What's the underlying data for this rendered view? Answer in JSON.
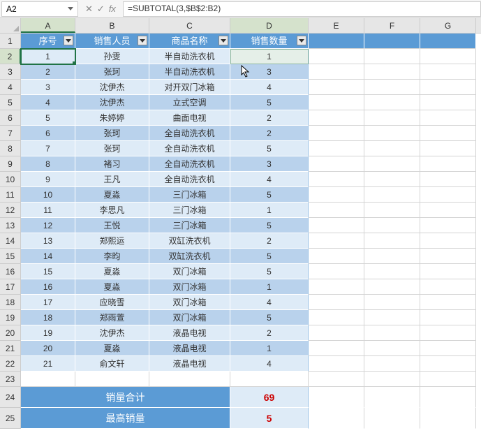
{
  "name_box": "A2",
  "formula": "=SUBTOTAL(3,$B$2:B2)",
  "cols": [
    "A",
    "B",
    "C",
    "D",
    "E",
    "F",
    "G"
  ],
  "headers": {
    "seq": "序号",
    "person": "销售人员",
    "product": "商品名称",
    "qty": "销售数量"
  },
  "chart_data": {
    "type": "table",
    "columns": [
      "序号",
      "销售人员",
      "商品名称",
      "销售数量"
    ],
    "rows": [
      {
        "seq": 1,
        "person": "孙雯",
        "product": "半自动洗衣机",
        "qty": 1
      },
      {
        "seq": 2,
        "person": "张珂",
        "product": "半自动洗衣机",
        "qty": 3
      },
      {
        "seq": 3,
        "person": "沈伊杰",
        "product": "对开双门冰箱",
        "qty": 4
      },
      {
        "seq": 4,
        "person": "沈伊杰",
        "product": "立式空调",
        "qty": 5
      },
      {
        "seq": 5,
        "person": "朱婷婷",
        "product": "曲面电视",
        "qty": 2
      },
      {
        "seq": 6,
        "person": "张珂",
        "product": "全自动洗衣机",
        "qty": 2
      },
      {
        "seq": 7,
        "person": "张珂",
        "product": "全自动洗衣机",
        "qty": 5
      },
      {
        "seq": 8,
        "person": "褚习",
        "product": "全自动洗衣机",
        "qty": 3
      },
      {
        "seq": 9,
        "person": "王凡",
        "product": "全自动洗衣机",
        "qty": 4
      },
      {
        "seq": 10,
        "person": "夏淼",
        "product": "三门冰箱",
        "qty": 5
      },
      {
        "seq": 11,
        "person": "李思凡",
        "product": "三门冰箱",
        "qty": 1
      },
      {
        "seq": 12,
        "person": "王悦",
        "product": "三门冰箱",
        "qty": 5
      },
      {
        "seq": 13,
        "person": "郑熙运",
        "product": "双缸洗衣机",
        "qty": 2
      },
      {
        "seq": 14,
        "person": "李昀",
        "product": "双缸洗衣机",
        "qty": 5
      },
      {
        "seq": 15,
        "person": "夏淼",
        "product": "双门冰箱",
        "qty": 5
      },
      {
        "seq": 16,
        "person": "夏淼",
        "product": "双门冰箱",
        "qty": 1
      },
      {
        "seq": 17,
        "person": "应晓雪",
        "product": "双门冰箱",
        "qty": 4
      },
      {
        "seq": 18,
        "person": "郑雨萱",
        "product": "双门冰箱",
        "qty": 5
      },
      {
        "seq": 19,
        "person": "沈伊杰",
        "product": "液晶电视",
        "qty": 2
      },
      {
        "seq": 20,
        "person": "夏淼",
        "product": "液晶电视",
        "qty": 1
      },
      {
        "seq": 21,
        "person": "俞文轩",
        "product": "液晶电视",
        "qty": 4
      }
    ],
    "summary": [
      {
        "label": "销量合计",
        "value": 69
      },
      {
        "label": "最高销量",
        "value": 5
      }
    ]
  }
}
